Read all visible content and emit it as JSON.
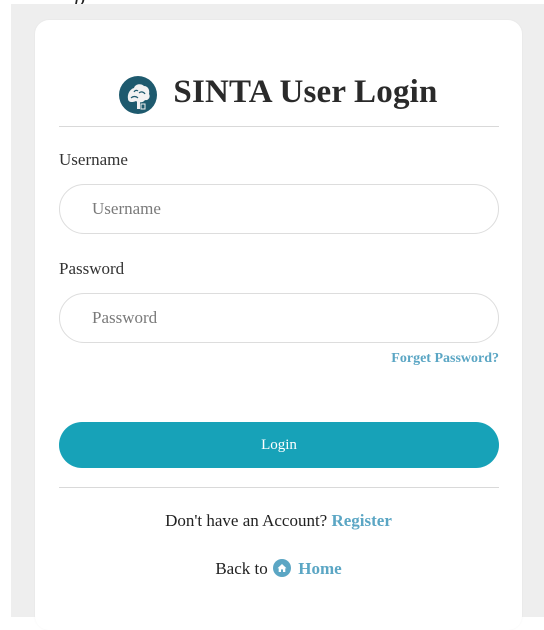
{
  "top_glyph": "p",
  "header": {
    "title": "SINTA User Login",
    "logo_icon": "sinta-tree-logo-icon"
  },
  "form": {
    "username_label": "Username",
    "username_placeholder": "Username",
    "username_value": "",
    "password_label": "Password",
    "password_placeholder": "Password",
    "password_value": "",
    "forget_link": "Forget Password?",
    "login_button": "Login"
  },
  "footer": {
    "no_account_text": "Don't have an Account?",
    "register_link": "Register",
    "back_to_text": "Back to",
    "home_icon": "home-icon",
    "home_link": "Home"
  },
  "colors": {
    "accent": "#17a2b8",
    "link": "#5ba6c4",
    "background": "#eeeeee",
    "logo": "#1e5a6e"
  }
}
